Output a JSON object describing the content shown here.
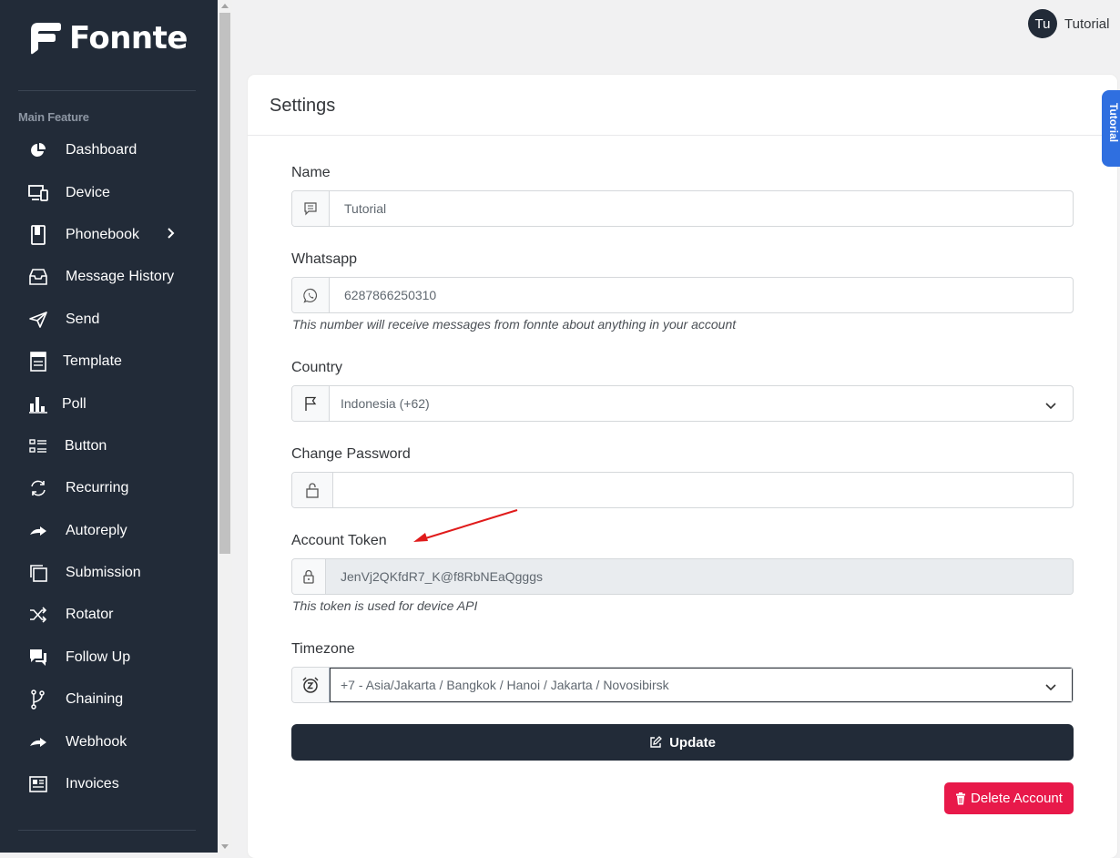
{
  "app": {
    "brand": "Fonnte"
  },
  "sidebar": {
    "section_title": "Main Feature",
    "items": [
      {
        "label": "Dashboard",
        "icon": "pie-chart-icon"
      },
      {
        "label": "Device",
        "icon": "devices-icon"
      },
      {
        "label": "Phonebook",
        "icon": "book-icon",
        "has_submenu": true
      },
      {
        "label": "Message History",
        "icon": "inbox-icon"
      },
      {
        "label": "Send",
        "icon": "send-icon"
      },
      {
        "label": "Template",
        "icon": "template-icon"
      },
      {
        "label": "Poll",
        "icon": "bar-chart-icon"
      },
      {
        "label": "Button",
        "icon": "list-icon"
      },
      {
        "label": "Recurring",
        "icon": "refresh-icon"
      },
      {
        "label": "Autoreply",
        "icon": "forward-icon"
      },
      {
        "label": "Submission",
        "icon": "copy-icon"
      },
      {
        "label": "Rotator",
        "icon": "shuffle-icon"
      },
      {
        "label": "Follow Up",
        "icon": "chat-icon"
      },
      {
        "label": "Chaining",
        "icon": "git-branch-icon"
      },
      {
        "label": "Webhook",
        "icon": "forward-icon"
      },
      {
        "label": "Invoices",
        "icon": "newspaper-icon"
      }
    ]
  },
  "header": {
    "avatar_initials": "Tu",
    "user_name": "Tutorial"
  },
  "tutorial_tab": {
    "label": "Tutorial"
  },
  "settings": {
    "title": "Settings",
    "name": {
      "label": "Name",
      "value": "Tutorial",
      "icon": "message-square-icon"
    },
    "whatsapp": {
      "label": "Whatsapp",
      "value": "6287866250310",
      "help": "This number will receive messages from fonnte about anything in your account",
      "icon": "whatsapp-icon"
    },
    "country": {
      "label": "Country",
      "value": "Indonesia (+62)",
      "icon": "flag-icon"
    },
    "password": {
      "label": "Change Password",
      "value": "",
      "icon": "lock-icon"
    },
    "token": {
      "label": "Account Token",
      "value": "JenVj2QKfdR7_K@f8RbNEaQgggs",
      "help": "This token is used for device API",
      "icon": "lock-icon"
    },
    "timezone": {
      "label": "Timezone",
      "value": "+7 - Asia/Jakarta / Bangkok / Hanoi / Jakarta / Novosibirsk",
      "icon": "alarm-clock-icon"
    },
    "update_label": "Update",
    "delete_label": "Delete Account"
  },
  "colors": {
    "sidebar_bg": "#222b38",
    "danger": "#e8194a",
    "accent_blue": "#2f6fe0",
    "annotation_arrow": "#e01b1b"
  }
}
